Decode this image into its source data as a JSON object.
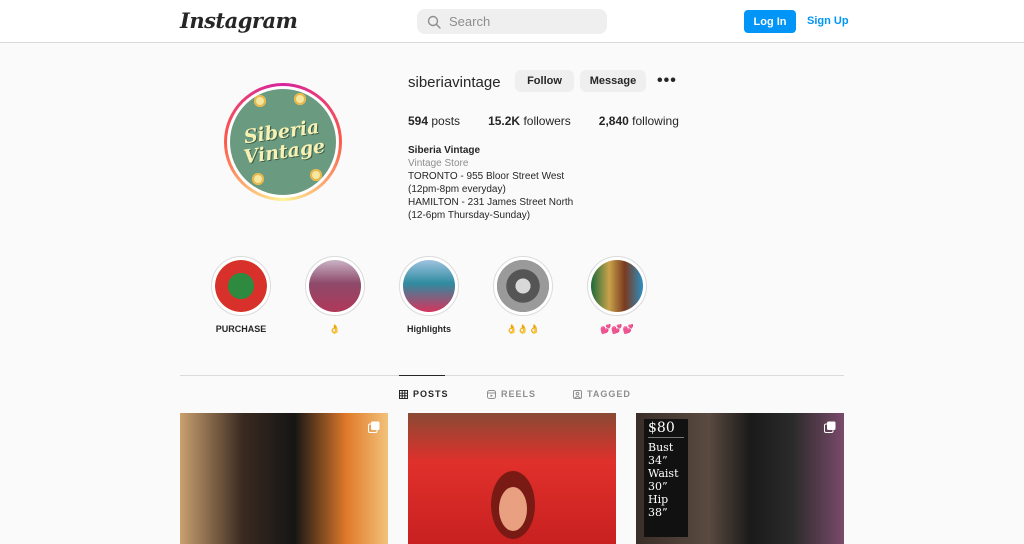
{
  "header": {
    "logo_text": "Instagram",
    "search_placeholder": "Search",
    "login_label": "Log In",
    "signup_label": "Sign Up"
  },
  "profile": {
    "username": "siberiavintage",
    "follow_label": "Follow",
    "message_label": "Message",
    "more_icon": "more-horizontal-icon",
    "avatar_text_line1": "Siberia",
    "avatar_text_line2": "Vintage",
    "stats": {
      "posts_count": "594",
      "posts_label": "posts",
      "followers_count": "15.2K",
      "followers_label": "followers",
      "following_count": "2,840",
      "following_label": "following"
    },
    "bio": {
      "name": "Siberia Vintage",
      "category": "Vintage Store",
      "lines": [
        "TORONTO - 955 Bloor Street West",
        "(12pm-8pm everyday)",
        "HAMILTON - 231 James Street North",
        "(12-6pm Thursday-Sunday)"
      ]
    }
  },
  "highlights": [
    {
      "label": "PURCHASE"
    },
    {
      "label": "👌"
    },
    {
      "label": "Highlights"
    },
    {
      "label": "👌👌👌"
    },
    {
      "label": "💕💕💕"
    }
  ],
  "tabs": [
    {
      "label": "POSTS",
      "icon": "grid-icon",
      "active": true
    },
    {
      "label": "REELS",
      "icon": "reels-icon",
      "active": false
    },
    {
      "label": "TAGGED",
      "icon": "tagged-icon",
      "active": false
    }
  ],
  "posts": {
    "third_post_card": {
      "price": "$80",
      "lines": [
        "Bust",
        "34”",
        "Waist",
        "30”",
        "Hip",
        "38”"
      ]
    }
  },
  "colors": {
    "brand_blue": "#0095f6",
    "avatar_green": "#6a9a80"
  }
}
